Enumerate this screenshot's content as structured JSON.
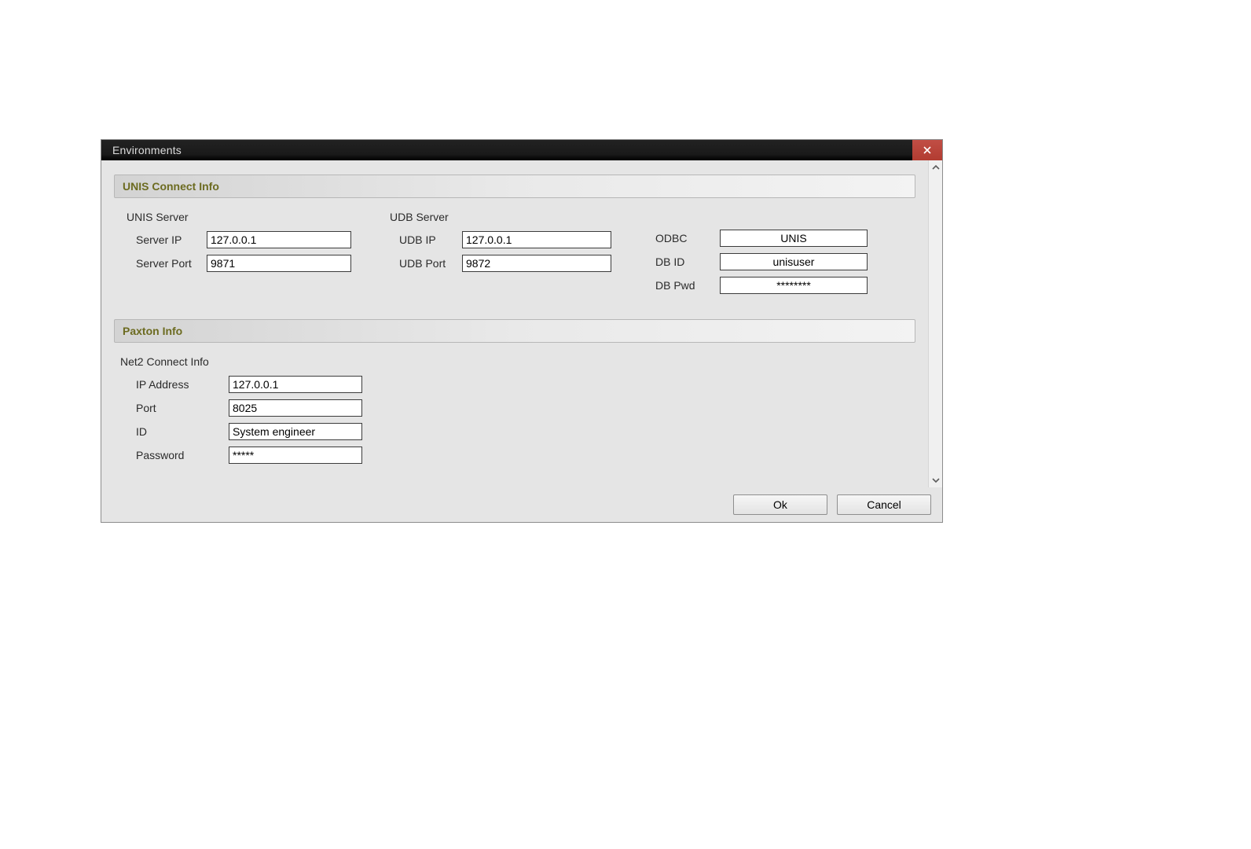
{
  "window": {
    "title": "Environments"
  },
  "sections": {
    "unis": {
      "header": "UNIS Connect Info",
      "unis_server": {
        "heading": "UNIS Server",
        "server_ip_label": "Server IP",
        "server_ip_value": "127.0.0.1",
        "server_port_label": "Server Port",
        "server_port_value": "9871"
      },
      "udb_server": {
        "heading": "UDB Server",
        "udb_ip_label": "UDB IP",
        "udb_ip_value": "127.0.0.1",
        "udb_port_label": "UDB Port",
        "udb_port_value": "9872"
      },
      "db": {
        "odbc_label": "ODBC",
        "odbc_value": "UNIS",
        "db_id_label": "DB ID",
        "db_id_value": "unisuser",
        "db_pwd_label": "DB Pwd",
        "db_pwd_value": "********"
      }
    },
    "paxton": {
      "header": "Paxton Info",
      "subheading": "Net2 Connect Info",
      "ip_label": "IP Address",
      "ip_value": "127.0.0.1",
      "port_label": "Port",
      "port_value": "8025",
      "id_label": "ID",
      "id_value": "System engineer",
      "password_label": "Password",
      "password_value": "*****"
    }
  },
  "buttons": {
    "ok": "Ok",
    "cancel": "Cancel"
  }
}
